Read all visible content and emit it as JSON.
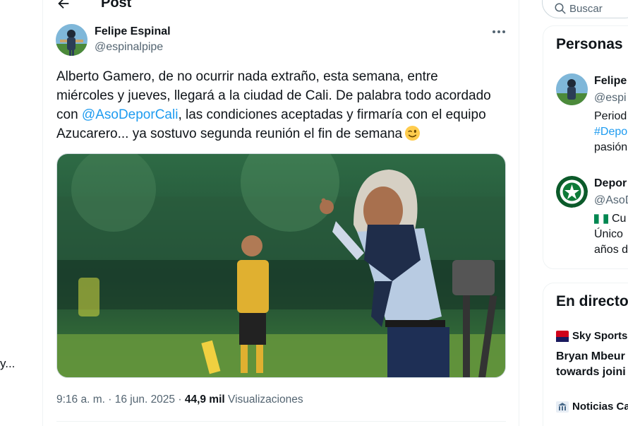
{
  "left_fragment": "y...",
  "header": {
    "title": "Post"
  },
  "author": {
    "display_name": "Felipe Espinal",
    "handle": "@espinalpipe"
  },
  "tweet": {
    "line1": "Alberto Gamero, de no ocurrir nada extraño, esta semana, entre",
    "line2": "miércoles y jueves, llegará a la ciudad de Cali. De palabra todo acordado",
    "line3_pre": "con ",
    "mention": "@AsoDeporCali",
    "line3_post": ", las condiciones aceptadas y firmaría con el equipo",
    "line4": "Azucarero... ya sostuvo segunda reunión el fin de semana",
    "emoji": "winking-face"
  },
  "meta": {
    "time": "9:16 a. m.",
    "sep1": " · ",
    "date": "16 jun. 2025",
    "sep2": " · ",
    "views_count": "44,9 mil",
    "views_label": " Visualizaciones"
  },
  "sidebar": {
    "search_placeholder": "Buscar",
    "people": {
      "title": "Personas",
      "items": [
        {
          "name": "Felipe",
          "handle": "@espi",
          "bio_lines": [
            "Period",
            "#Depo",
            "pasión"
          ]
        },
        {
          "name": "Depor",
          "handle": "@AsoD",
          "bio_lines": [
            "Cu",
            "Único",
            "años d"
          ]
        }
      ]
    },
    "live": {
      "title": "En directo",
      "items": [
        {
          "source": "Sky Sports",
          "headline_lines": [
            "Bryan Mbeur",
            "towards joini"
          ]
        },
        {
          "source": "Noticias Ca",
          "headline_lines": []
        }
      ]
    }
  },
  "colors": {
    "accent": "#1d9bf0",
    "secondary_text": "#536471",
    "border": "#eff3f4"
  }
}
